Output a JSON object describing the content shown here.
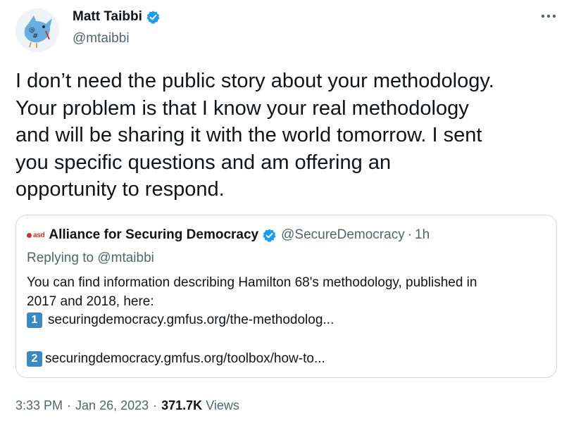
{
  "author": {
    "display_name": "Matt Taibbi",
    "handle": "@mtaibbi",
    "verified": true,
    "avatar_icon": "blue-bird-avatar"
  },
  "more_icon": "more-horizontal-icon",
  "tweet": {
    "lines": [
      "I don’t need the public story about your methodology.",
      "Your problem is that I know your real methodology",
      "and will be sharing it with the world tomorrow. I sent",
      "you specific questions and am offering an",
      "opportunity to respond."
    ]
  },
  "quote": {
    "logo_text": "asd",
    "display_name": "Alliance for Securing Democracy",
    "handle": "@SecureDemocracy",
    "separator": "·",
    "time": "1h",
    "replying_to": "Replying to @mtaibbi",
    "text_lines": [
      "You can find information describing Hamilton 68's methodology, published in",
      "2017 and 2018, here:"
    ],
    "links": [
      {
        "number": "1",
        "url": "securingdemocracy.gmfus.org/the-methodolog..."
      },
      {
        "number": "2",
        "url": "securingdemocracy.gmfus.org/toolbox/how-to..."
      }
    ]
  },
  "footer": {
    "time": "3:33 PM",
    "date": "Jan 26, 2023",
    "separator": "·",
    "views_count": "371.7K",
    "views_label": "Views"
  },
  "colors": {
    "text": "#0f1419",
    "secondary": "#536471",
    "verified": "#1d9bf0",
    "border": "#cfd9de",
    "keycap": "#3b88c3",
    "asd_red": "#c0392b"
  }
}
